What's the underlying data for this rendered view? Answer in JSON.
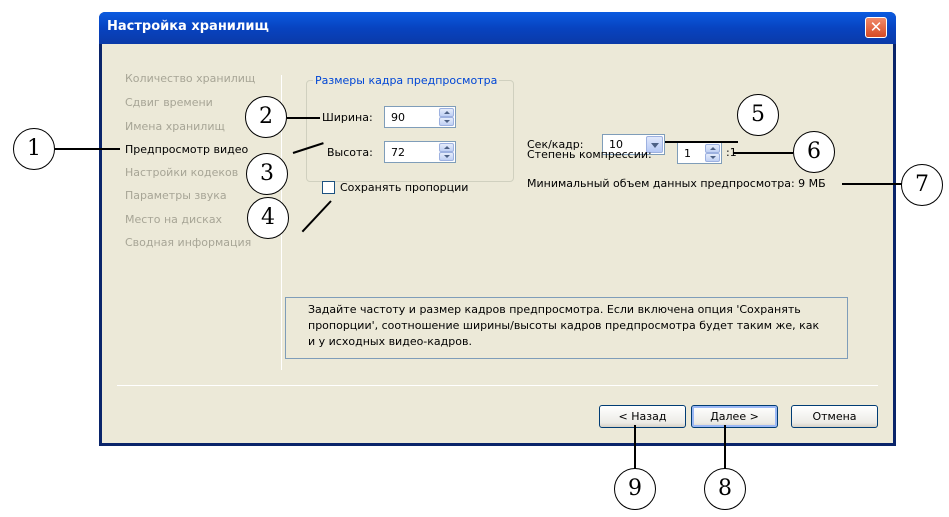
{
  "window": {
    "title": "Настройка хранилищ",
    "close_label": "✕"
  },
  "nav": {
    "items": [
      "Количество хранилищ",
      "Сдвиг времени",
      "Имена хранилищ",
      "Предпросмотр видео",
      "Настройки кодеков",
      "Параметры звука",
      "Место на дисках",
      "Сводная информация"
    ],
    "active_index": 3
  },
  "frame_group": {
    "legend": "Размеры кадра предпросмотра",
    "width_label": "Ширина:",
    "width_value": "90",
    "height_label": "Высота:",
    "height_value": "72",
    "keep_ratio_label": "Сохранять пропорции"
  },
  "settings": {
    "fps_label": "Сек/кадр:",
    "fps_value": "10",
    "compression_label": "Степень компрессии:",
    "compression_value": "1",
    "compression_suffix": ":1",
    "min_size_text": "Минимальный объем данных предпросмотра: 9 МБ"
  },
  "hint": {
    "text": "Задайте частоту и размер кадров предпросмотра. Если включена опция 'Сохранять пропорции', соотношение ширины/высоты кадров предпросмотра будет таким же, как и у исходных видео-кадров."
  },
  "buttons": {
    "back": "< Назад",
    "next": "Далее >",
    "cancel": "Отмена"
  },
  "callouts": [
    "1",
    "2",
    "3",
    "4",
    "5",
    "6",
    "7",
    "8",
    "9"
  ]
}
